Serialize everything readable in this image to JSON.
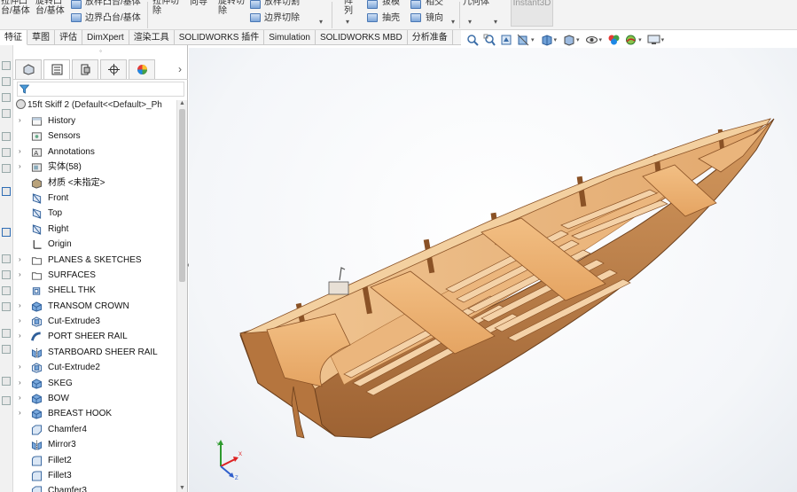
{
  "ribbon": {
    "items": [
      {
        "label": "拉伸凸\n台/基体"
      },
      {
        "label": "旋转凸\n台/基体"
      },
      {
        "label": "放样凸台/基体"
      },
      {
        "label": "边界凸台/基体"
      },
      {
        "label": "拉伸切\n除"
      },
      {
        "label": "向导"
      },
      {
        "label": "旋转切\n除"
      },
      {
        "label": "放样切割"
      },
      {
        "label": "边界切除"
      },
      {
        "label": "阵\n列"
      },
      {
        "label": "拔模"
      },
      {
        "label": "相交"
      },
      {
        "label": "抽壳"
      },
      {
        "label": "镜向"
      },
      {
        "label": "几何体"
      }
    ],
    "instant3d": "Instant3D"
  },
  "tabs": [
    {
      "label": "特征",
      "active": true
    },
    {
      "label": "草图"
    },
    {
      "label": "评估"
    },
    {
      "label": "DimXpert"
    },
    {
      "label": "渲染工具"
    },
    {
      "label": "SOLIDWORKS 插件"
    },
    {
      "label": "Simulation"
    },
    {
      "label": "SOLIDWORKS MBD"
    },
    {
      "label": "分析准备"
    }
  ],
  "hud": {
    "icons": [
      "zoom-to-fit-icon",
      "zoom-area-icon",
      "previous-view-icon",
      "section-view-icon",
      "view-orientation-icon",
      "display-style-icon",
      "hide-show-items-icon",
      "edit-appearance-icon",
      "apply-scene-icon",
      "view-settings-icon"
    ]
  },
  "panel": {
    "handle_glyph": "◦",
    "tabs": [
      "feature-manager-icon",
      "property-manager-icon",
      "configuration-manager-icon",
      "dimxpert-manager-icon",
      "display-manager-icon"
    ],
    "more": "›",
    "root_label": "15ft Skiff 2  (Default<<Default>_Ph"
  },
  "tree": [
    {
      "label": "History",
      "icon": "history-icon",
      "expand": "›"
    },
    {
      "label": "Sensors",
      "icon": "sensors-icon",
      "expand": ""
    },
    {
      "label": "Annotations",
      "icon": "annotations-icon",
      "expand": "›"
    },
    {
      "label": "实体(58)",
      "icon": "solid-bodies-icon",
      "expand": "›"
    },
    {
      "label": "材质 <未指定>",
      "icon": "material-icon",
      "expand": ""
    },
    {
      "label": "Front",
      "icon": "plane-icon",
      "expand": ""
    },
    {
      "label": "Top",
      "icon": "plane-icon",
      "expand": ""
    },
    {
      "label": "Right",
      "icon": "plane-icon",
      "expand": ""
    },
    {
      "label": "Origin",
      "icon": "origin-icon",
      "expand": ""
    },
    {
      "label": "PLANES & SKETCHES",
      "icon": "folder-icon",
      "expand": "›"
    },
    {
      "label": "SURFACES",
      "icon": "folder-icon",
      "expand": "›"
    },
    {
      "label": "SHELL THK",
      "icon": "shell-icon",
      "expand": ""
    },
    {
      "label": "TRANSOM CROWN",
      "icon": "boss-extrude-icon",
      "expand": "›"
    },
    {
      "label": "Cut-Extrude3",
      "icon": "cut-extrude-icon",
      "expand": "›"
    },
    {
      "label": "PORT SHEER RAIL",
      "icon": "sweep-icon",
      "expand": "›"
    },
    {
      "label": "STARBOARD SHEER RAIL",
      "icon": "mirror-icon",
      "expand": ""
    },
    {
      "label": "Cut-Extrude2",
      "icon": "cut-extrude-icon",
      "expand": "›"
    },
    {
      "label": "SKEG",
      "icon": "boss-extrude-icon",
      "expand": "›"
    },
    {
      "label": "BOW",
      "icon": "boss-extrude-icon",
      "expand": "›"
    },
    {
      "label": "BREAST HOOK",
      "icon": "boss-extrude-icon",
      "expand": "›"
    },
    {
      "label": "Chamfer4",
      "icon": "chamfer-icon",
      "expand": ""
    },
    {
      "label": "Mirror3",
      "icon": "mirror-icon",
      "expand": ""
    },
    {
      "label": "Fillet2",
      "icon": "fillet-icon",
      "expand": ""
    },
    {
      "label": "Fillet3",
      "icon": "fillet-icon",
      "expand": ""
    },
    {
      "label": "Chamfer3",
      "icon": "chamfer-icon",
      "expand": ""
    }
  ],
  "triad": {
    "x_label": "X",
    "y_label": "Y",
    "z_label": "Z"
  },
  "colors": {
    "wood_light": "#e8b27a",
    "wood_mid": "#c98a4e",
    "wood_dark": "#8a5226",
    "accent_blue": "#2f6db5"
  }
}
